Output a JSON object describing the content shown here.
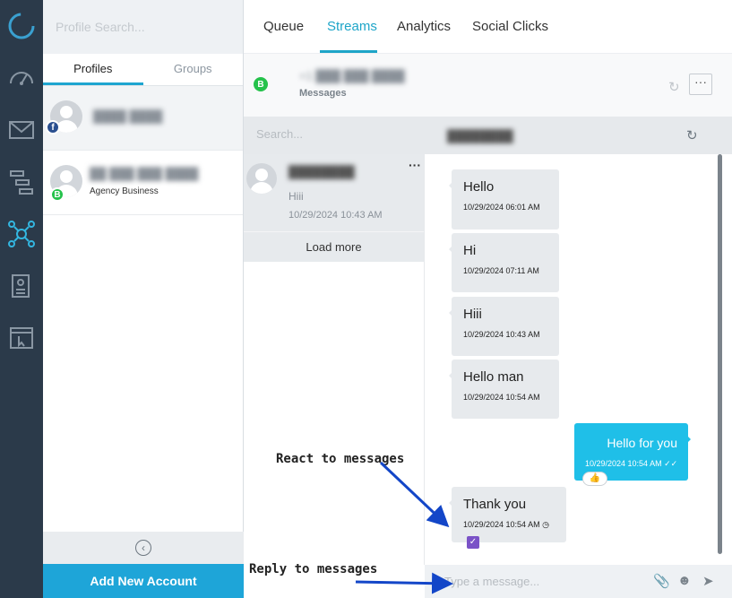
{
  "profiles": {
    "search_placeholder": "Profile Search...",
    "tabs": [
      "Profiles",
      "Groups"
    ],
    "business_label": "Agency Business",
    "add_button": "Add New Account"
  },
  "nav": {
    "items": [
      "Queue",
      "Streams",
      "Analytics",
      "Social Clicks"
    ],
    "active": "Streams"
  },
  "account": {
    "label": "Messages",
    "badge": "B"
  },
  "conversations": {
    "search_placeholder": "Search...",
    "items": [
      {
        "preview": "Hiii",
        "time": "10/29/2024 10:43 AM"
      }
    ],
    "load_more": "Load more"
  },
  "chat": {
    "incoming": [
      {
        "text": "Hello",
        "time": "10/29/2024 06:01 AM"
      },
      {
        "text": "Hi",
        "time": "10/29/2024 07:11 AM"
      },
      {
        "text": "Hiii",
        "time": "10/29/2024 10:43 AM"
      },
      {
        "text": "Hello man",
        "time": "10/29/2024 10:54 AM"
      },
      {
        "text": "Thank you",
        "time": "10/29/2024 10:54 AM"
      }
    ],
    "outgoing": {
      "text": "Hello for you",
      "time": "10/29/2024 10:54 AM"
    },
    "composer_placeholder": "Type a message..."
  },
  "annotations": {
    "react": "React to messages",
    "reply": "Reply to messages"
  },
  "colors": {
    "accent": "#1ea5d8",
    "outgoing_bubble": "#1fbfe8",
    "arrow": "#1346c8",
    "rail": "#2b3a4a"
  }
}
